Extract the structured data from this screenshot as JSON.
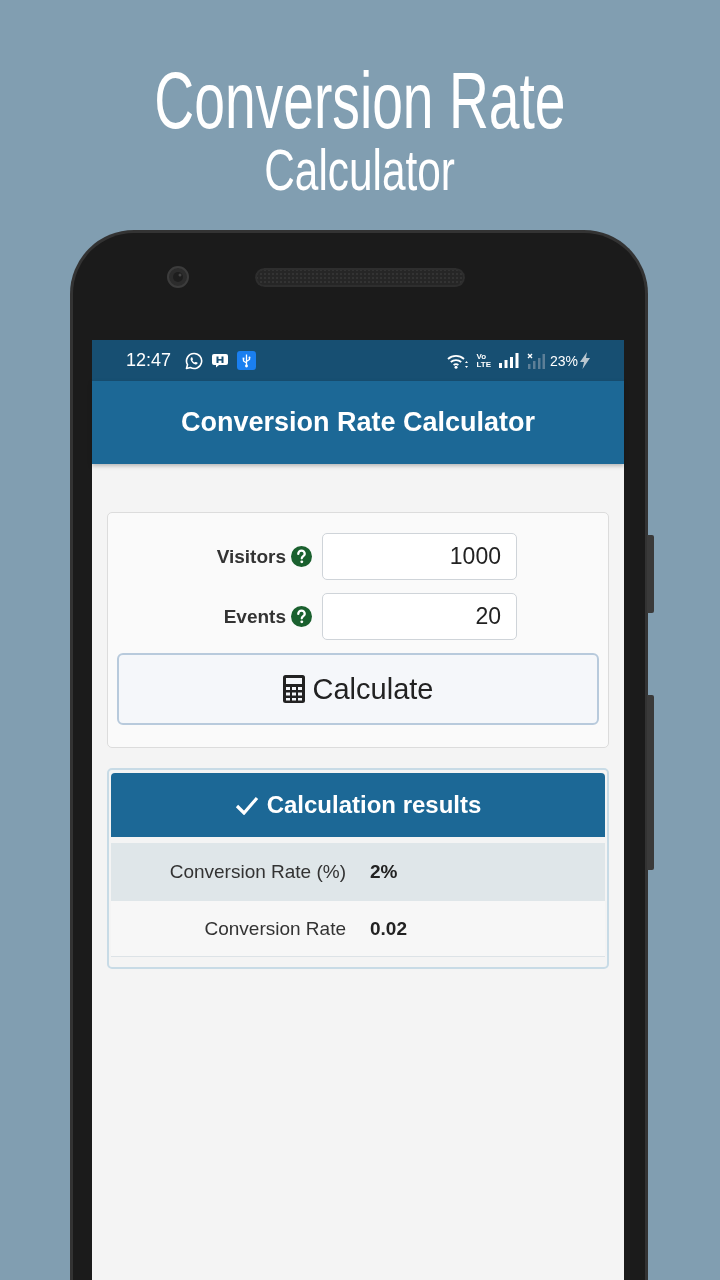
{
  "page_title": {
    "line1": "Conversion Rate",
    "line2": "Calculator"
  },
  "status_bar": {
    "time": "12:47",
    "network_label": [
      "Vo",
      "LTE"
    ],
    "battery": "23%"
  },
  "app_bar": {
    "title": "Conversion Rate Calculator"
  },
  "form": {
    "fields": [
      {
        "label": "Visitors",
        "value": "1000"
      },
      {
        "label": "Events",
        "value": "20"
      }
    ],
    "button": "Calculate"
  },
  "results": {
    "title": "Calculation results",
    "rows": [
      {
        "label": "Conversion Rate (%)",
        "value": "2%"
      },
      {
        "label": "Conversion Rate",
        "value": "0.02"
      }
    ]
  }
}
